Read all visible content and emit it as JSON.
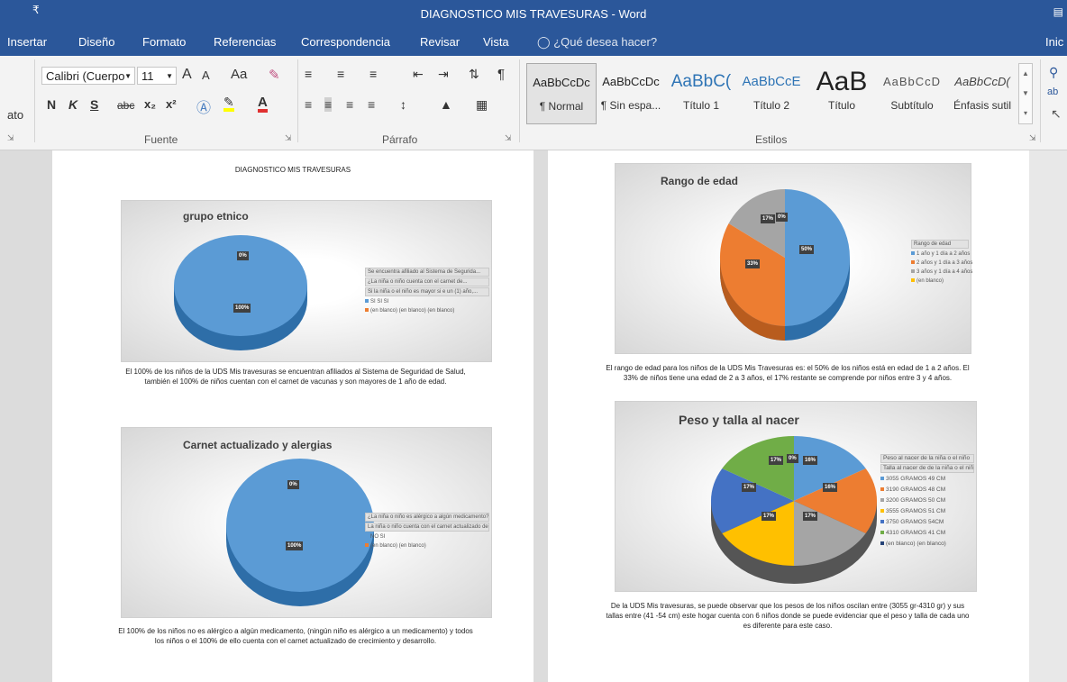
{
  "titlebar": {
    "qat": "₹",
    "title": "DIAGNOSTICO MIS TRAVESURAS - Word",
    "right_icon": "ribbon-display-icon"
  },
  "menu": {
    "tabs": [
      "Insertar",
      "Diseño",
      "Formato",
      "Referencias",
      "Correspondencia",
      "Revisar",
      "Vista"
    ],
    "tell_me": "¿Qué desea hacer?",
    "right": "Inic"
  },
  "ribbon": {
    "clipboard_partial": "ato",
    "font": {
      "name": "Calibri (Cuerpo",
      "size": "11",
      "grow": "A",
      "shrink": "A",
      "case": "Aa",
      "bold": "N",
      "italic": "K",
      "underline": "S",
      "strike": "abc",
      "sub": "x₂",
      "sup": "x²",
      "label": "Fuente"
    },
    "paragraph_label": "Párrafo",
    "styles_label": "Estilos",
    "styles": [
      {
        "sample": "AaBbCcDc",
        "name": "¶ Normal"
      },
      {
        "sample": "AaBbCcDc",
        "name": "¶ Sin espa..."
      },
      {
        "sample": "AaBbC(",
        "name": "Título 1"
      },
      {
        "sample": "AaBbCcE",
        "name": "Título 2"
      },
      {
        "sample": "AaB",
        "name": "Título"
      },
      {
        "sample": "AaBbCcD",
        "name": "Subtítulo"
      },
      {
        "sample": "AaBbCcD(",
        "name": "Énfasis sutil"
      }
    ]
  },
  "colors": {
    "brand": "#2b579a",
    "blue": "#5b9bd5",
    "orange": "#ed7d31",
    "gray": "#a5a5a5",
    "yellow": "#ffc000",
    "darkblue": "#4472c4",
    "green": "#70ad47",
    "navy": "#264478"
  },
  "page_left": {
    "heading": "DIAGNOSTICO MIS TRAVESURAS",
    "chart1": {
      "title": "grupo etnico",
      "legend_dropdowns": [
        "Se encuentra afiliado al Sistema de Segurida...",
        "¿La niña o niño cuenta con el carnet de...",
        "Si la niña o el niño es mayor si e un (1) año,..."
      ],
      "legend_items": [
        "SI SI SI",
        "(en blanco) (en blanco) (en blanco)"
      ],
      "labels": [
        "0%",
        "100%"
      ]
    },
    "caption1": "El 100% de los niños de la UDS Mis travesuras se encuentran afiliados al Sistema de Seguridad de Salud, también el 100% de niños cuentan con el carnet de vacunas y son mayores de 1 año de edad.",
    "chart2": {
      "title": "Carnet actualizado y alergias",
      "legend_dropdowns": [
        "¿La niña o niño es alérgico a algún medicamento?",
        "La niña o niño cuenta con el carnet actualizado de..."
      ],
      "legend_items": [
        "NO SI",
        "(en blanco) (en blanco)"
      ],
      "labels": [
        "0%",
        "100%"
      ]
    },
    "caption2": "El 100% de los niños no es alérgico a algún medicamento, (ningún niño es alérgico a un medicamento) y todos los niños o el 100% de ello cuenta con el carnet actualizado de crecimiento y desarrollo."
  },
  "page_right": {
    "chart3": {
      "title": "Rango de edad",
      "legend_dropdowns": [
        "Rango de edad"
      ],
      "legend_items": [
        "1 año y 1 día a 2 años",
        "2 años y 1 día a 3 años",
        "3 años y 1 día a 4 años",
        "(en blanco)"
      ],
      "labels": [
        "17%",
        "0%",
        "50%",
        "33%"
      ]
    },
    "caption3": "El rango de edad para los niños de la UDS Mis Travesuras es: el 50% de los niños está en edad de 1 a 2 años. El 33% de niños tiene una edad de 2 a 3 años, el 17% restante se comprende por niños entre 3 y 4 años.",
    "chart4": {
      "title": "Peso y talla al nacer",
      "legend_dropdowns": [
        "Peso al nacer de la niña o el niño",
        "Talla al nacer de de la niña o el niño"
      ],
      "legend_items": [
        "3055 GRAMOS 49 CM",
        "3190 GRAMOS 48 CM",
        "3200 GRAMOS 50 CM",
        "3555 GRAMOS 51 CM",
        "3750 GRAMOS 54CM",
        "4310 GRAMOS 41 CM",
        "(en blanco) (en blanco)"
      ],
      "labels": [
        "17%",
        "0%",
        "16%",
        "17%",
        "16%",
        "17%",
        "17%"
      ]
    },
    "caption4": "De la UDS Mis travesuras, se puede observar que los pesos de los niños oscilan entre (3055 gr-4310 gr) y sus tallas entre (41 -54 cm) este hogar cuenta con 6 niños donde se puede evidenciar que el peso y talla de cada uno es diferente para este caso."
  }
}
